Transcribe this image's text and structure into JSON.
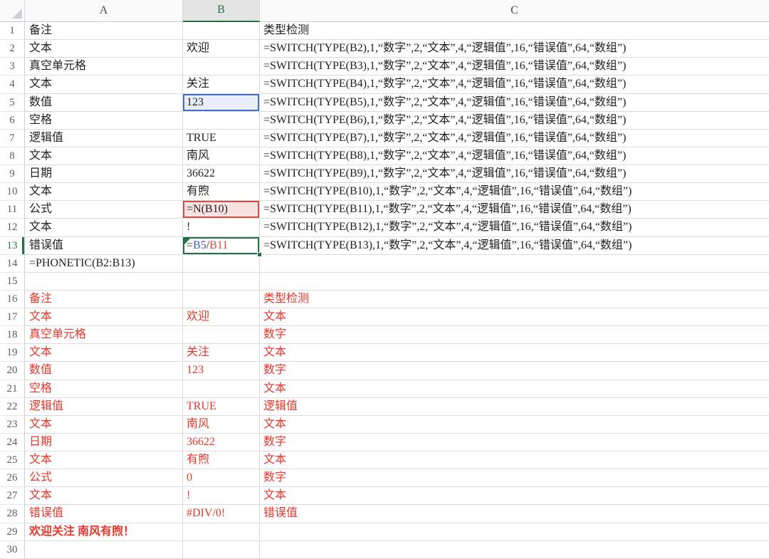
{
  "sheet": {
    "columns": [
      "A",
      "B",
      "C"
    ],
    "selected_column": "B",
    "active_cell": "B13",
    "formula_edit": {
      "cell": "B13",
      "parts": [
        {
          "text": "=",
          "color": "black"
        },
        {
          "text": "B5",
          "color": "blue"
        },
        {
          "text": "/",
          "color": "black"
        },
        {
          "text": "B11",
          "color": "red"
        }
      ]
    },
    "reference_highlights": [
      {
        "ref": "B5",
        "color": "blue"
      },
      {
        "ref": "B11",
        "color": "red"
      }
    ],
    "rows": [
      {
        "n": 1,
        "a": "备注",
        "c": "类型检测"
      },
      {
        "n": 2,
        "a": "文本",
        "b": "欢迎",
        "c": "=SWITCH(TYPE(B2),1,“数字”,2,“文本”,4,“逻辑值”,16,“错误值”,64,“数组”)"
      },
      {
        "n": 3,
        "a": "真空单元格",
        "c": "=SWITCH(TYPE(B3),1,“数字”,2,“文本”,4,“逻辑值”,16,“错误值”,64,“数组”)"
      },
      {
        "n": 4,
        "a": "文本",
        "b": "关注",
        "c": "=SWITCH(TYPE(B4),1,“数字”,2,“文本”,4,“逻辑值”,16,“错误值”,64,“数组”)"
      },
      {
        "n": 5,
        "a": "数值",
        "b": "123",
        "c": "=SWITCH(TYPE(B5),1,“数字”,2,“文本”,4,“逻辑值”,16,“错误值”,64,“数组”)"
      },
      {
        "n": 6,
        "a": "空格",
        "c": "=SWITCH(TYPE(B6),1,“数字”,2,“文本”,4,“逻辑值”,16,“错误值”,64,“数组”)"
      },
      {
        "n": 7,
        "a": "逻辑值",
        "b": "TRUE",
        "c": "=SWITCH(TYPE(B7),1,“数字”,2,“文本”,4,“逻辑值”,16,“错误值”,64,“数组”)"
      },
      {
        "n": 8,
        "a": "文本",
        "b": "南风",
        "c": "=SWITCH(TYPE(B8),1,“数字”,2,“文本”,4,“逻辑值”,16,“错误值”,64,“数组”)"
      },
      {
        "n": 9,
        "a": "日期",
        "b": "36622",
        "c": "=SWITCH(TYPE(B9),1,“数字”,2,“文本”,4,“逻辑值”,16,“错误值”,64,“数组”)"
      },
      {
        "n": 10,
        "a": "文本",
        "b": "有煦",
        "c": "=SWITCH(TYPE(B10),1,“数字”,2,“文本”,4,“逻辑值”,16,“错误值”,64,“数组”)"
      },
      {
        "n": 11,
        "a": "公式",
        "b": "=N(B10)",
        "c": "=SWITCH(TYPE(B11),1,“数字”,2,“文本”,4,“逻辑值”,16,“错误值”,64,“数组”)"
      },
      {
        "n": 12,
        "a": "文本",
        "b": "!",
        "c": "=SWITCH(TYPE(B12),1,“数字”,2,“文本”,4,“逻辑值”,16,“错误值”,64,“数组”)"
      },
      {
        "n": 13,
        "a": "错误值",
        "c": "=SWITCH(TYPE(B13),1,“数字”,2,“文本”,4,“逻辑值”,16,“错误值”,64,“数组”)",
        "warning": true
      },
      {
        "n": 14,
        "a": "=PHONETIC(B2:B13)"
      },
      {
        "n": 15
      },
      {
        "n": 16,
        "a": "备注",
        "c": "类型检测",
        "red": true
      },
      {
        "n": 17,
        "a": "文本",
        "b": "欢迎",
        "c": "文本",
        "red": true
      },
      {
        "n": 18,
        "a": "真空单元格",
        "c": "数字",
        "red": true
      },
      {
        "n": 19,
        "a": "文本",
        "b": "关注",
        "c": "文本",
        "red": true
      },
      {
        "n": 20,
        "a": "数值",
        "b": "123",
        "c": "数字",
        "red": true
      },
      {
        "n": 21,
        "a": "空格",
        "c": "文本",
        "red": true
      },
      {
        "n": 22,
        "a": "逻辑值",
        "b": "TRUE",
        "c": "逻辑值",
        "red": true
      },
      {
        "n": 23,
        "a": "文本",
        "b": "南风",
        "c": "文本",
        "red": true
      },
      {
        "n": 24,
        "a": "日期",
        "b": "36622",
        "c": "数字",
        "red": true
      },
      {
        "n": 25,
        "a": "文本",
        "b": "有煦",
        "c": "文本",
        "red": true
      },
      {
        "n": 26,
        "a": "公式",
        "b": "0",
        "c": "数字",
        "red": true
      },
      {
        "n": 27,
        "a": "文本",
        "b": "!",
        "c": "文本",
        "red": true
      },
      {
        "n": 28,
        "a": "错误值",
        "b": "#DIV/0!",
        "c": "错误值",
        "red": true
      },
      {
        "n": 29,
        "a": "欢迎关注 南风有煦！",
        "red": true,
        "bold": true
      },
      {
        "n": 30
      }
    ]
  },
  "icons": {
    "warning_glyph": "!",
    "error_checking": "warning-triangle",
    "select_all": "corner-triangle"
  },
  "colors": {
    "red_text": "#e8352a",
    "edit_green": "#217346",
    "ref_blue_border": "#4472c4",
    "ref_blue_fill": "#e9effa",
    "ref_red_border": "#d0504a",
    "ref_red_fill": "#f9e3e2",
    "formula_blue": "#3b5bd6",
    "formula_red": "#d8443c",
    "warning_orange": "#e79b2e"
  }
}
